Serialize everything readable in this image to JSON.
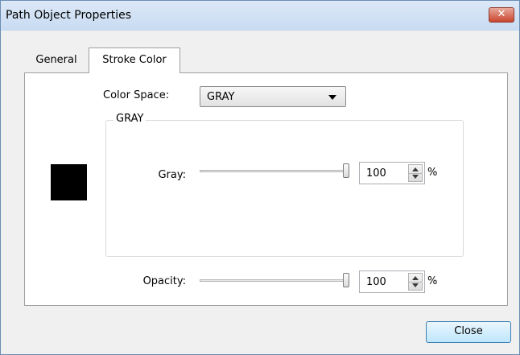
{
  "window": {
    "title": "Path Object Properties",
    "close_glyph": "✕"
  },
  "tabs": [
    {
      "label": "General",
      "active": false
    },
    {
      "label": "Stroke Color",
      "active": true
    }
  ],
  "color_space": {
    "label": "Color Space:",
    "value": "GRAY"
  },
  "group": {
    "label": "GRAY"
  },
  "swatch": {
    "color": "#000000"
  },
  "gray": {
    "label": "Gray:",
    "value": "100",
    "unit": "%",
    "slider_fraction": 1.0
  },
  "opacity": {
    "label": "Opacity:",
    "value": "100",
    "unit": "%",
    "slider_fraction": 1.0
  },
  "buttons": {
    "close": "Close"
  }
}
